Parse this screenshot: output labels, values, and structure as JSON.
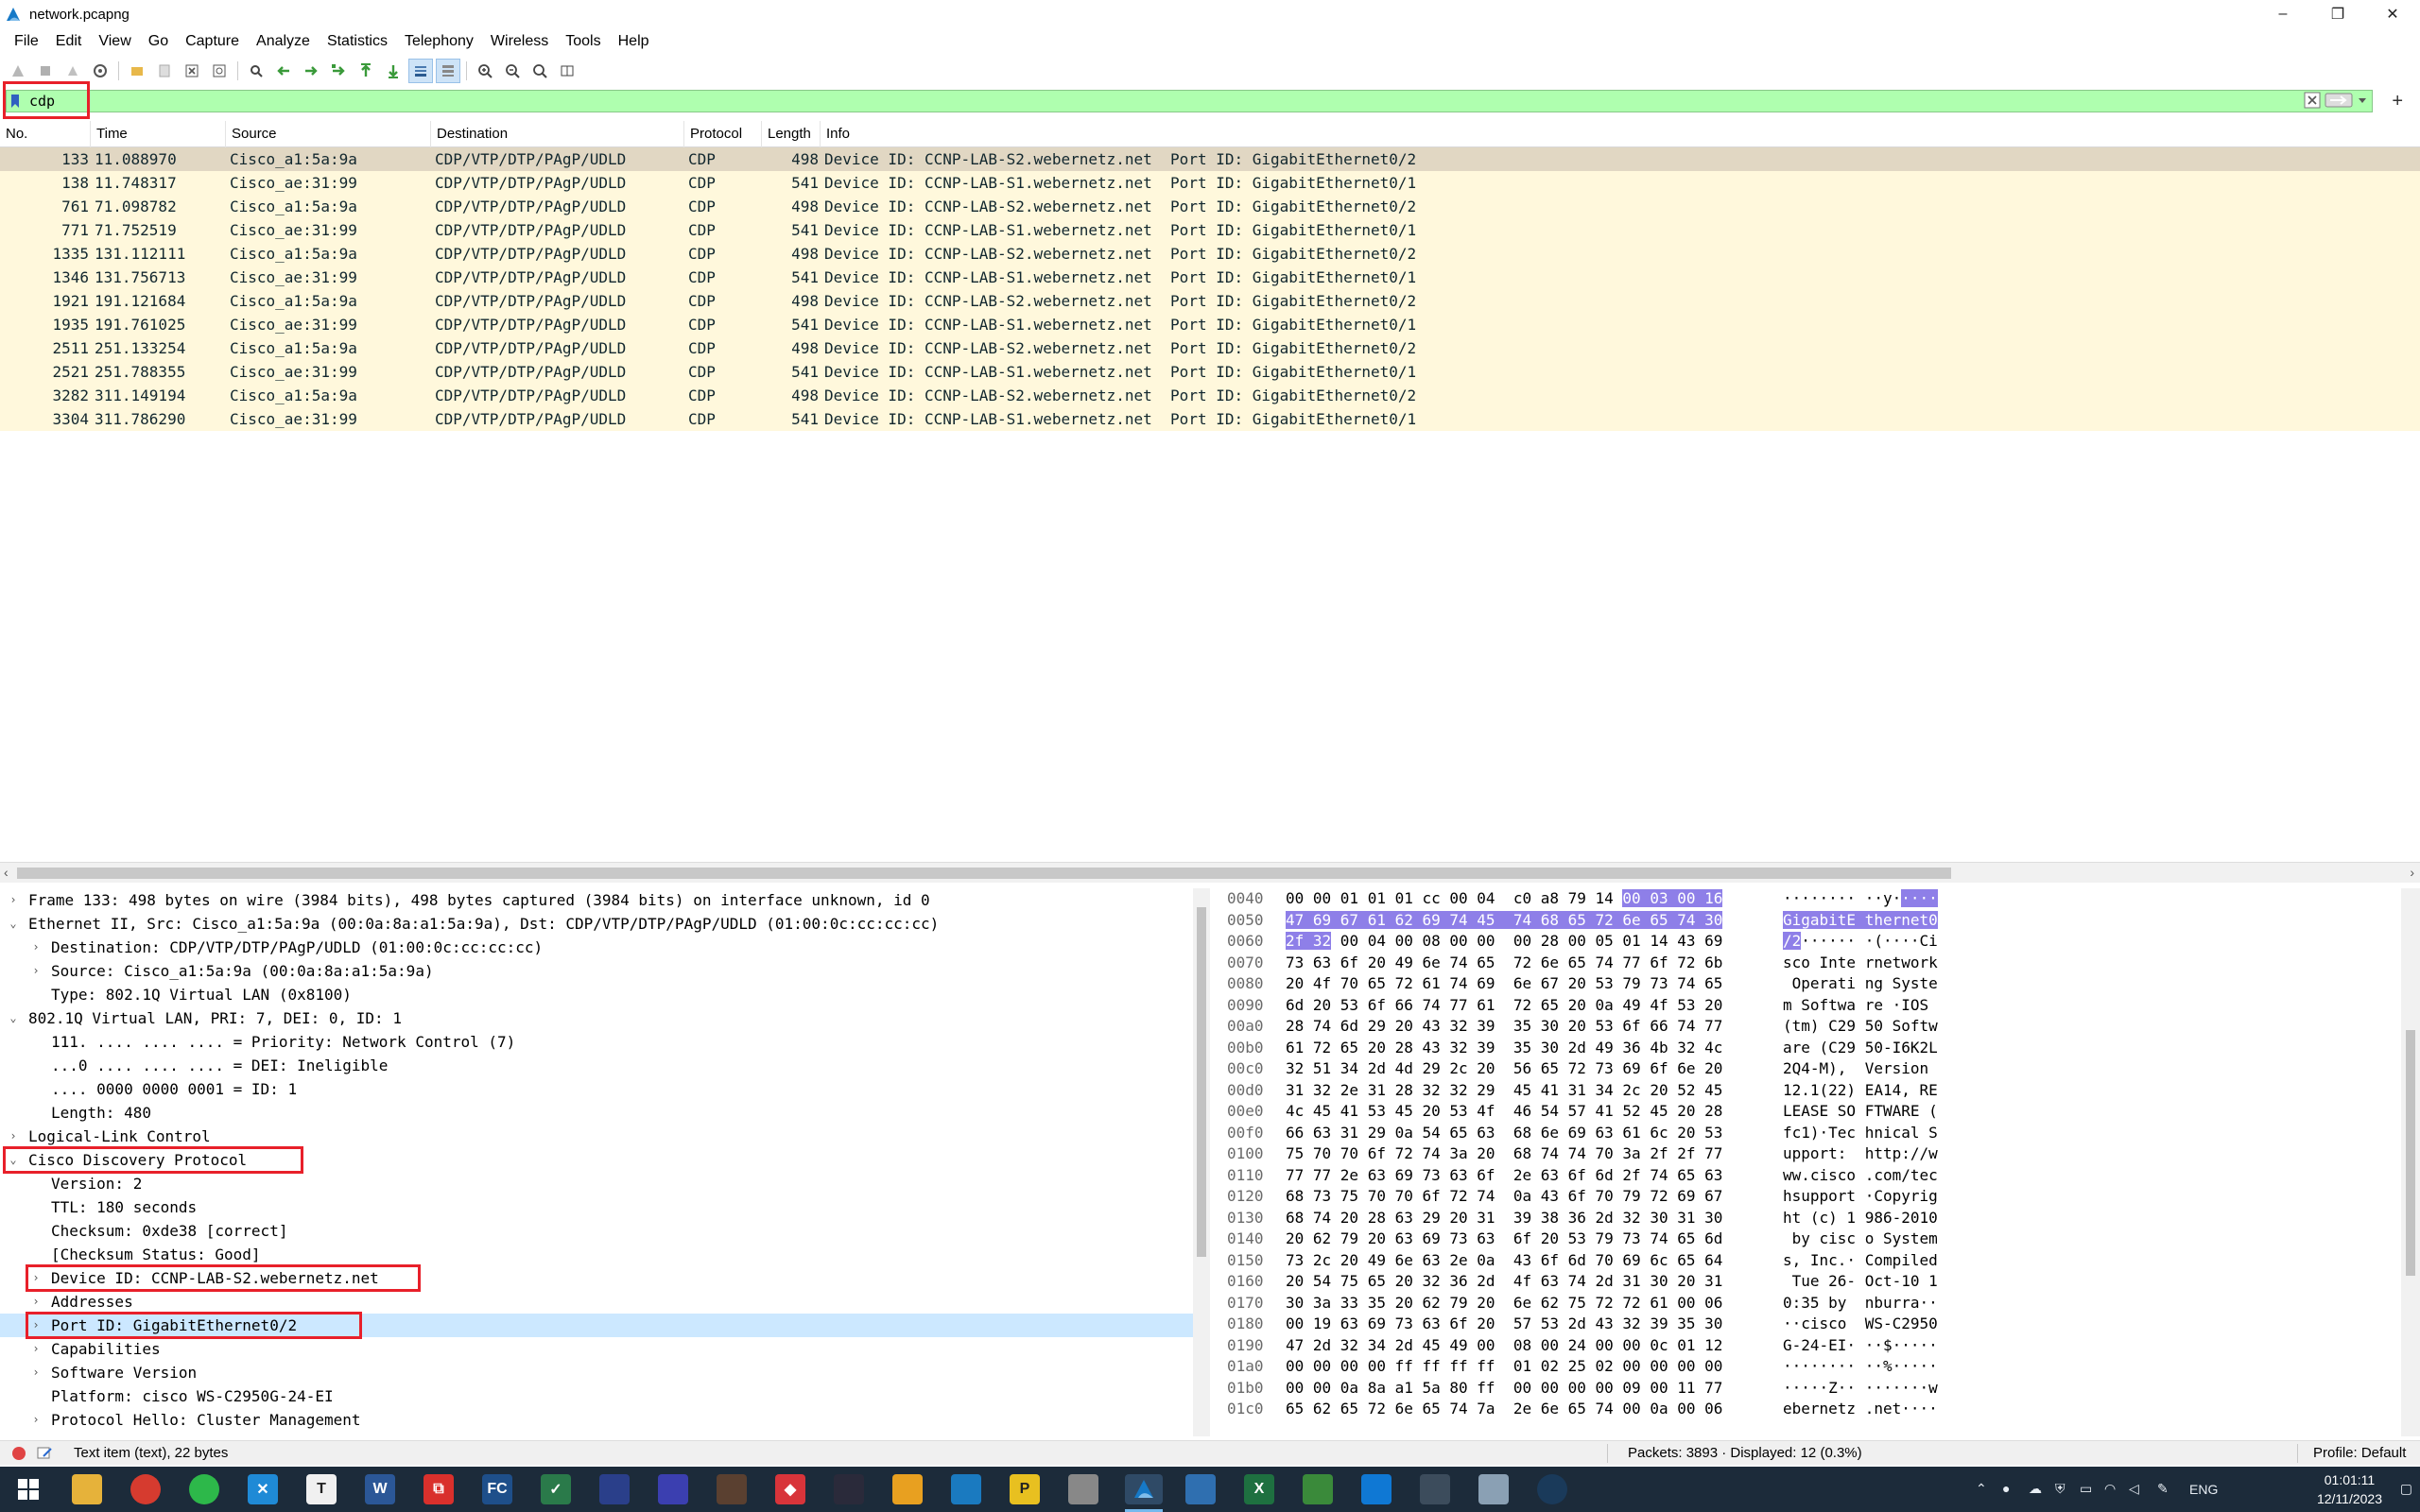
{
  "window": {
    "title": "network.pcapng",
    "minimize": "–",
    "maximize": "❐",
    "close": "✕"
  },
  "menu": [
    "File",
    "Edit",
    "View",
    "Go",
    "Capture",
    "Analyze",
    "Statistics",
    "Telephony",
    "Wireless",
    "Tools",
    "Help"
  ],
  "toolbar_icons": [
    "start-capture-icon",
    "stop-capture-icon",
    "restart-capture-icon",
    "capture-options-icon",
    "open-file-icon",
    "save-file-icon",
    "close-file-icon",
    "reload-file-icon",
    "find-packet-icon",
    "go-back-icon",
    "go-forward-icon",
    "go-to-packet-icon",
    "go-first-icon",
    "go-last-icon",
    "auto-scroll-icon",
    "colorize-icon",
    "zoom-in-icon",
    "zoom-out-icon",
    "normal-size-icon",
    "resize-columns-icon"
  ],
  "filter": {
    "value": "cdp",
    "background": "#afffaf",
    "add_button": "+"
  },
  "packet_list": {
    "columns": [
      "No.",
      "Time",
      "Source",
      "Destination",
      "Protocol",
      "Length",
      "Info"
    ],
    "rows": [
      {
        "no": "133",
        "time": "11.088970",
        "src": "Cisco_a1:5a:9a",
        "dst": "CDP/VTP/DTP/PAgP/UDLD",
        "proto": "CDP",
        "len": "498",
        "info": "Device ID: CCNP-LAB-S2.webernetz.net  Port ID: GigabitEthernet0/2"
      },
      {
        "no": "138",
        "time": "11.748317",
        "src": "Cisco_ae:31:99",
        "dst": "CDP/VTP/DTP/PAgP/UDLD",
        "proto": "CDP",
        "len": "541",
        "info": "Device ID: CCNP-LAB-S1.webernetz.net  Port ID: GigabitEthernet0/1"
      },
      {
        "no": "761",
        "time": "71.098782",
        "src": "Cisco_a1:5a:9a",
        "dst": "CDP/VTP/DTP/PAgP/UDLD",
        "proto": "CDP",
        "len": "498",
        "info": "Device ID: CCNP-LAB-S2.webernetz.net  Port ID: GigabitEthernet0/2"
      },
      {
        "no": "771",
        "time": "71.752519",
        "src": "Cisco_ae:31:99",
        "dst": "CDP/VTP/DTP/PAgP/UDLD",
        "proto": "CDP",
        "len": "541",
        "info": "Device ID: CCNP-LAB-S1.webernetz.net  Port ID: GigabitEthernet0/1"
      },
      {
        "no": "1335",
        "time": "131.112111",
        "src": "Cisco_a1:5a:9a",
        "dst": "CDP/VTP/DTP/PAgP/UDLD",
        "proto": "CDP",
        "len": "498",
        "info": "Device ID: CCNP-LAB-S2.webernetz.net  Port ID: GigabitEthernet0/2"
      },
      {
        "no": "1346",
        "time": "131.756713",
        "src": "Cisco_ae:31:99",
        "dst": "CDP/VTP/DTP/PAgP/UDLD",
        "proto": "CDP",
        "len": "541",
        "info": "Device ID: CCNP-LAB-S1.webernetz.net  Port ID: GigabitEthernet0/1"
      },
      {
        "no": "1921",
        "time": "191.121684",
        "src": "Cisco_a1:5a:9a",
        "dst": "CDP/VTP/DTP/PAgP/UDLD",
        "proto": "CDP",
        "len": "498",
        "info": "Device ID: CCNP-LAB-S2.webernetz.net  Port ID: GigabitEthernet0/2"
      },
      {
        "no": "1935",
        "time": "191.761025",
        "src": "Cisco_ae:31:99",
        "dst": "CDP/VTP/DTP/PAgP/UDLD",
        "proto": "CDP",
        "len": "541",
        "info": "Device ID: CCNP-LAB-S1.webernetz.net  Port ID: GigabitEthernet0/1"
      },
      {
        "no": "2511",
        "time": "251.133254",
        "src": "Cisco_a1:5a:9a",
        "dst": "CDP/VTP/DTP/PAgP/UDLD",
        "proto": "CDP",
        "len": "498",
        "info": "Device ID: CCNP-LAB-S2.webernetz.net  Port ID: GigabitEthernet0/2"
      },
      {
        "no": "2521",
        "time": "251.788355",
        "src": "Cisco_ae:31:99",
        "dst": "CDP/VTP/DTP/PAgP/UDLD",
        "proto": "CDP",
        "len": "541",
        "info": "Device ID: CCNP-LAB-S1.webernetz.net  Port ID: GigabitEthernet0/1"
      },
      {
        "no": "3282",
        "time": "311.149194",
        "src": "Cisco_a1:5a:9a",
        "dst": "CDP/VTP/DTP/PAgP/UDLD",
        "proto": "CDP",
        "len": "498",
        "info": "Device ID: CCNP-LAB-S2.webernetz.net  Port ID: GigabitEthernet0/2"
      },
      {
        "no": "3304",
        "time": "311.786290",
        "src": "Cisco_ae:31:99",
        "dst": "CDP/VTP/DTP/PAgP/UDLD",
        "proto": "CDP",
        "len": "541",
        "info": "Device ID: CCNP-LAB-S1.webernetz.net  Port ID: GigabitEthernet0/1"
      }
    ],
    "row_color": "#fff8dc",
    "selected_color": "#e1d7c3"
  },
  "details": [
    {
      "level": 0,
      "arrow": "›",
      "text": "Frame 133: 498 bytes on wire (3984 bits), 498 bytes captured (3984 bits) on interface unknown, id 0"
    },
    {
      "level": 0,
      "arrow": "⌄",
      "text": "Ethernet II, Src: Cisco_a1:5a:9a (00:0a:8a:a1:5a:9a), Dst: CDP/VTP/DTP/PAgP/UDLD (01:00:0c:cc:cc:cc)"
    },
    {
      "level": 1,
      "arrow": "›",
      "text": "Destination: CDP/VTP/DTP/PAgP/UDLD (01:00:0c:cc:cc:cc)"
    },
    {
      "level": 1,
      "arrow": "›",
      "text": "Source: Cisco_a1:5a:9a (00:0a:8a:a1:5a:9a)"
    },
    {
      "level": 1,
      "arrow": "",
      "text": "Type: 802.1Q Virtual LAN (0x8100)"
    },
    {
      "level": 0,
      "arrow": "⌄",
      "text": "802.1Q Virtual LAN, PRI: 7, DEI: 0, ID: 1"
    },
    {
      "level": 1,
      "arrow": "",
      "text": "111. .... .... .... = Priority: Network Control (7)"
    },
    {
      "level": 1,
      "arrow": "",
      "text": "...0 .... .... .... = DEI: Ineligible"
    },
    {
      "level": 1,
      "arrow": "",
      "text": ".... 0000 0000 0001 = ID: 1"
    },
    {
      "level": 1,
      "arrow": "",
      "text": "Length: 480"
    },
    {
      "level": 0,
      "arrow": "›",
      "text": "Logical-Link Control"
    },
    {
      "level": 0,
      "arrow": "⌄",
      "text": "Cisco Discovery Protocol"
    },
    {
      "level": 1,
      "arrow": "",
      "text": "Version: 2"
    },
    {
      "level": 1,
      "arrow": "",
      "text": "TTL: 180 seconds"
    },
    {
      "level": 1,
      "arrow": "",
      "text": "Checksum: 0xde38 [correct]"
    },
    {
      "level": 1,
      "arrow": "",
      "text": "[Checksum Status: Good]"
    },
    {
      "level": 1,
      "arrow": "›",
      "text": "Device ID: CCNP-LAB-S2.webernetz.net"
    },
    {
      "level": 1,
      "arrow": "›",
      "text": "Addresses"
    },
    {
      "level": 1,
      "arrow": "›",
      "text": "Port ID: GigabitEthernet0/2",
      "highlight": true
    },
    {
      "level": 1,
      "arrow": "›",
      "text": "Capabilities"
    },
    {
      "level": 1,
      "arrow": "›",
      "text": "Software Version"
    },
    {
      "level": 1,
      "arrow": "",
      "text": "Platform: cisco WS-C2950G-24-EI"
    },
    {
      "level": 1,
      "arrow": "›",
      "text": "Protocol Hello: Cluster Management"
    }
  ],
  "bytes": [
    {
      "off": "0040",
      "hex": [
        [
          "00 00 01 01 01 cc 00 04  c0 a8 79 14 ",
          ""
        ],
        [
          "00 03 00 16",
          "hi"
        ]
      ],
      "asc": [
        [
          "········ ··y·",
          ""
        ],
        [
          "····",
          "hi"
        ]
      ]
    },
    {
      "off": "0050",
      "hex": [
        [
          "47 69 67 61 62 69 74 45  74 68 65 72 6e 65 74 30",
          "hi"
        ]
      ],
      "asc": [
        [
          "GigabitE thernet0",
          "hi"
        ]
      ]
    },
    {
      "off": "0060",
      "hex": [
        [
          "2f 32",
          "hi"
        ],
        [
          " 00 04 00 08 00 00  00 28 00 05 01 14 43 69",
          ""
        ]
      ],
      "asc": [
        [
          "/2",
          "hi"
        ],
        [
          "······ ·(····Ci",
          ""
        ]
      ]
    },
    {
      "off": "0070",
      "hex": [
        [
          "73 63 6f 20 49 6e 74 65  72 6e 65 74 77 6f 72 6b",
          ""
        ]
      ],
      "asc": [
        [
          "sco Inte rnetwork",
          ""
        ]
      ]
    },
    {
      "off": "0080",
      "hex": [
        [
          "20 4f 70 65 72 61 74 69  6e 67 20 53 79 73 74 65",
          ""
        ]
      ],
      "asc": [
        [
          " Operati ng Syste",
          ""
        ]
      ]
    },
    {
      "off": "0090",
      "hex": [
        [
          "6d 20 53 6f 66 74 77 61  72 65 20 0a 49 4f 53 20",
          ""
        ]
      ],
      "asc": [
        [
          "m Softwa re ·IOS ",
          ""
        ]
      ]
    },
    {
      "off": "00a0",
      "hex": [
        [
          "28 74 6d 29 20 43 32 39  35 30 20 53 6f 66 74 77",
          ""
        ]
      ],
      "asc": [
        [
          "(tm) C29 50 Softw",
          ""
        ]
      ]
    },
    {
      "off": "00b0",
      "hex": [
        [
          "61 72 65 20 28 43 32 39  35 30 2d 49 36 4b 32 4c",
          ""
        ]
      ],
      "asc": [
        [
          "are (C29 50-I6K2L",
          ""
        ]
      ]
    },
    {
      "off": "00c0",
      "hex": [
        [
          "32 51 34 2d 4d 29 2c 20  56 65 72 73 69 6f 6e 20",
          ""
        ]
      ],
      "asc": [
        [
          "2Q4-M),  Version ",
          ""
        ]
      ]
    },
    {
      "off": "00d0",
      "hex": [
        [
          "31 32 2e 31 28 32 32 29  45 41 31 34 2c 20 52 45",
          ""
        ]
      ],
      "asc": [
        [
          "12.1(22) EA14, RE",
          ""
        ]
      ]
    },
    {
      "off": "00e0",
      "hex": [
        [
          "4c 45 41 53 45 20 53 4f  46 54 57 41 52 45 20 28",
          ""
        ]
      ],
      "asc": [
        [
          "LEASE SO FTWARE (",
          ""
        ]
      ]
    },
    {
      "off": "00f0",
      "hex": [
        [
          "66 63 31 29 0a 54 65 63  68 6e 69 63 61 6c 20 53",
          ""
        ]
      ],
      "asc": [
        [
          "fc1)·Tec hnical S",
          ""
        ]
      ]
    },
    {
      "off": "0100",
      "hex": [
        [
          "75 70 70 6f 72 74 3a 20  68 74 74 70 3a 2f 2f 77",
          ""
        ]
      ],
      "asc": [
        [
          "upport:  http://w",
          ""
        ]
      ]
    },
    {
      "off": "0110",
      "hex": [
        [
          "77 77 2e 63 69 73 63 6f  2e 63 6f 6d 2f 74 65 63",
          ""
        ]
      ],
      "asc": [
        [
          "ww.cisco .com/tec",
          ""
        ]
      ]
    },
    {
      "off": "0120",
      "hex": [
        [
          "68 73 75 70 70 6f 72 74  0a 43 6f 70 79 72 69 67",
          ""
        ]
      ],
      "asc": [
        [
          "hsupport ·Copyrig",
          ""
        ]
      ]
    },
    {
      "off": "0130",
      "hex": [
        [
          "68 74 20 28 63 29 20 31  39 38 36 2d 32 30 31 30",
          ""
        ]
      ],
      "asc": [
        [
          "ht (c) 1 986-2010",
          ""
        ]
      ]
    },
    {
      "off": "0140",
      "hex": [
        [
          "20 62 79 20 63 69 73 63  6f 20 53 79 73 74 65 6d",
          ""
        ]
      ],
      "asc": [
        [
          " by cisc o System",
          ""
        ]
      ]
    },
    {
      "off": "0150",
      "hex": [
        [
          "73 2c 20 49 6e 63 2e 0a  43 6f 6d 70 69 6c 65 64",
          ""
        ]
      ],
      "asc": [
        [
          "s, Inc.· Compiled",
          ""
        ]
      ]
    },
    {
      "off": "0160",
      "hex": [
        [
          "20 54 75 65 20 32 36 2d  4f 63 74 2d 31 30 20 31",
          ""
        ]
      ],
      "asc": [
        [
          " Tue 26- Oct-10 1",
          ""
        ]
      ]
    },
    {
      "off": "0170",
      "hex": [
        [
          "30 3a 33 35 20 62 79 20  6e 62 75 72 72 61 00 06",
          ""
        ]
      ],
      "asc": [
        [
          "0:35 by  nburra··",
          ""
        ]
      ]
    },
    {
      "off": "0180",
      "hex": [
        [
          "00 19 63 69 73 63 6f 20  57 53 2d 43 32 39 35 30",
          ""
        ]
      ],
      "asc": [
        [
          "··cisco  WS-C2950",
          ""
        ]
      ]
    },
    {
      "off": "0190",
      "hex": [
        [
          "47 2d 32 34 2d 45 49 00  08 00 24 00 00 0c 01 12",
          ""
        ]
      ],
      "asc": [
        [
          "G-24-EI· ··$·····",
          ""
        ]
      ]
    },
    {
      "off": "01a0",
      "hex": [
        [
          "00 00 00 00 ff ff ff ff  01 02 25 02 00 00 00 00",
          ""
        ]
      ],
      "asc": [
        [
          "········ ··%·····",
          ""
        ]
      ]
    },
    {
      "off": "01b0",
      "hex": [
        [
          "00 00 0a 8a a1 5a 80 ff  00 00 00 00 09 00 11 77",
          ""
        ]
      ],
      "asc": [
        [
          "·····Z·· ·······w",
          ""
        ]
      ]
    },
    {
      "off": "01c0",
      "hex": [
        [
          "65 62 65 72 6e 65 74 7a  2e 6e 65 74 00 0a 00 06",
          ""
        ]
      ],
      "asc": [
        [
          "ebernetz .net····",
          ""
        ]
      ]
    }
  ],
  "status": {
    "left_text": "Text item (text), 22 bytes",
    "packets": "Packets: 3893 · Displayed: 12 (0.3%)",
    "profile": "Profile: Default"
  },
  "taskbar": {
    "lang": "ENG",
    "time": "01:01:11",
    "date": "12/11/2023"
  }
}
